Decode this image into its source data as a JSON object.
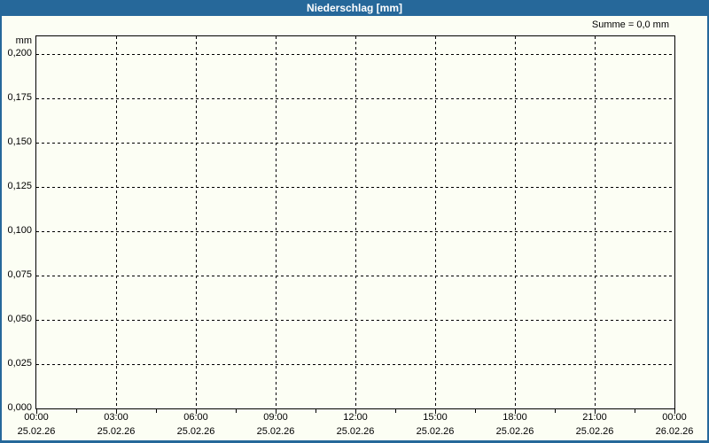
{
  "window": {
    "title": "Niederschlag [mm]"
  },
  "summary": {
    "label": "Summe = 0,0 mm"
  },
  "colors": {
    "frame_blue": "#26689a",
    "background": "#fcfef4",
    "grid": "#000000",
    "text": "#000000",
    "title_text": "#ffffff"
  },
  "chart_data": {
    "type": "line",
    "title": "Niederschlag [mm]",
    "summary": "Summe = 0,0 mm",
    "ylabel": "mm",
    "xlabel": "",
    "ylim": [
      0.0,
      0.2
    ],
    "ytick_interval": 0.025,
    "grid": true,
    "legend_position": "none",
    "yticks": [
      {
        "label": "0,200",
        "value": 0.2
      },
      {
        "label": "0,175",
        "value": 0.175
      },
      {
        "label": "0,150",
        "value": 0.15
      },
      {
        "label": "0,125",
        "value": 0.125
      },
      {
        "label": "0,100",
        "value": 0.1
      },
      {
        "label": "0,075",
        "value": 0.075
      },
      {
        "label": "0,050",
        "value": 0.05
      },
      {
        "label": "0,025",
        "value": 0.025
      },
      {
        "label": "0,000",
        "value": 0.0
      }
    ],
    "xticks": [
      {
        "time": "00:00",
        "date": "25.02.26"
      },
      {
        "time": "03:00",
        "date": "25.02.26"
      },
      {
        "time": "06:00",
        "date": "25.02.26"
      },
      {
        "time": "09:00",
        "date": "25.02.26"
      },
      {
        "time": "12:00",
        "date": "25.02.26"
      },
      {
        "time": "15:00",
        "date": "25.02.26"
      },
      {
        "time": "18:00",
        "date": "25.02.26"
      },
      {
        "time": "21:00",
        "date": "25.02.26"
      },
      {
        "time": "00:00",
        "date": "26.02.26"
      }
    ],
    "minor_tick_hours": 1.5,
    "series": [
      {
        "name": "Niederschlag",
        "unit": "mm",
        "values": [],
        "total": 0.0
      }
    ]
  }
}
